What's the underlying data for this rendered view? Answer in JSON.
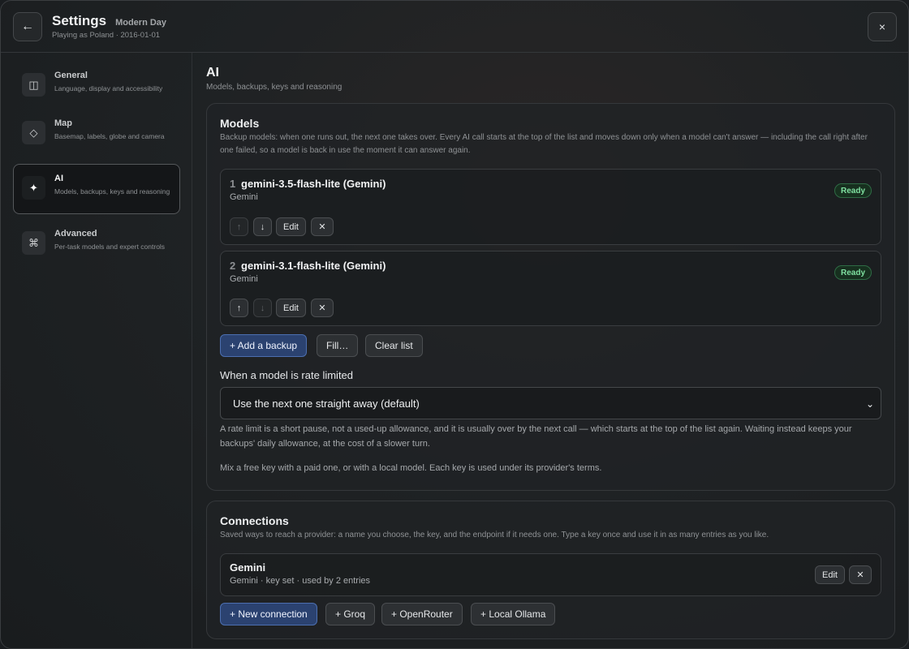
{
  "header": {
    "title": "Settings",
    "scenario": "Modern Day",
    "subtitle": "Playing as Poland · 2016-01-01",
    "back_icon": "←",
    "close_icon": "×"
  },
  "sidebar": {
    "items": [
      {
        "title": "General",
        "desc": "Language, display and accessibility",
        "icon": "◫"
      },
      {
        "title": "Map",
        "desc": "Basemap, labels, globe and camera",
        "icon": "◇"
      },
      {
        "title": "AI",
        "desc": "Models, backups, keys and reasoning",
        "icon": "✦"
      },
      {
        "title": "Advanced",
        "desc": "Per-task models and expert controls",
        "icon": "⌘"
      }
    ]
  },
  "section": {
    "title": "AI",
    "subtitle": "Models, backups, keys and reasoning"
  },
  "models": {
    "title": "Models",
    "desc": "Backup models: when one runs out, the next one takes over. Every AI call starts at the top of the list and moves down only when a model can't answer — including the call right after one failed, so a model is back in use the moment it can answer again.",
    "list": [
      {
        "num": "1",
        "name": "gemini-3.5-flash-lite (Gemini)",
        "provider": "Gemini",
        "status": "Ready"
      },
      {
        "num": "2",
        "name": "gemini-3.1-flash-lite (Gemini)",
        "provider": "Gemini",
        "status": "Ready"
      }
    ],
    "up_icon": "↑",
    "down_icon": "↓",
    "edit_label": "Edit",
    "remove_icon": "✕",
    "add_backup_label": "+ Add a backup",
    "fill_label": "Fill…",
    "clear_label": "Clear list",
    "rate_label": "When a model is rate limited",
    "rate_value": "Use the next one straight away (default)",
    "chevron_icon": "⌄",
    "rate_note": "A rate limit is a short pause, not a used-up allowance, and it is usually over by the next call — which starts at the top of the list again. Waiting instead keeps your backups' daily allowance, at the cost of a slower turn.",
    "mix_note": "Mix a free key with a paid one, or with a local model. Each key is used under its provider's terms."
  },
  "connections": {
    "title": "Connections",
    "desc": "Saved ways to reach a provider: a name you choose, the key, and the endpoint if it needs one. Type a key once and use it in as many entries as you like.",
    "items": [
      {
        "name": "Gemini",
        "info": "Gemini · key set · used by 2 entries"
      }
    ],
    "edit_label": "Edit",
    "remove_icon": "✕",
    "new_label": "+ New connection",
    "groq_label": "+ Groq",
    "openrouter_label": "+ OpenRouter",
    "ollama_label": "+ Local Ollama"
  }
}
